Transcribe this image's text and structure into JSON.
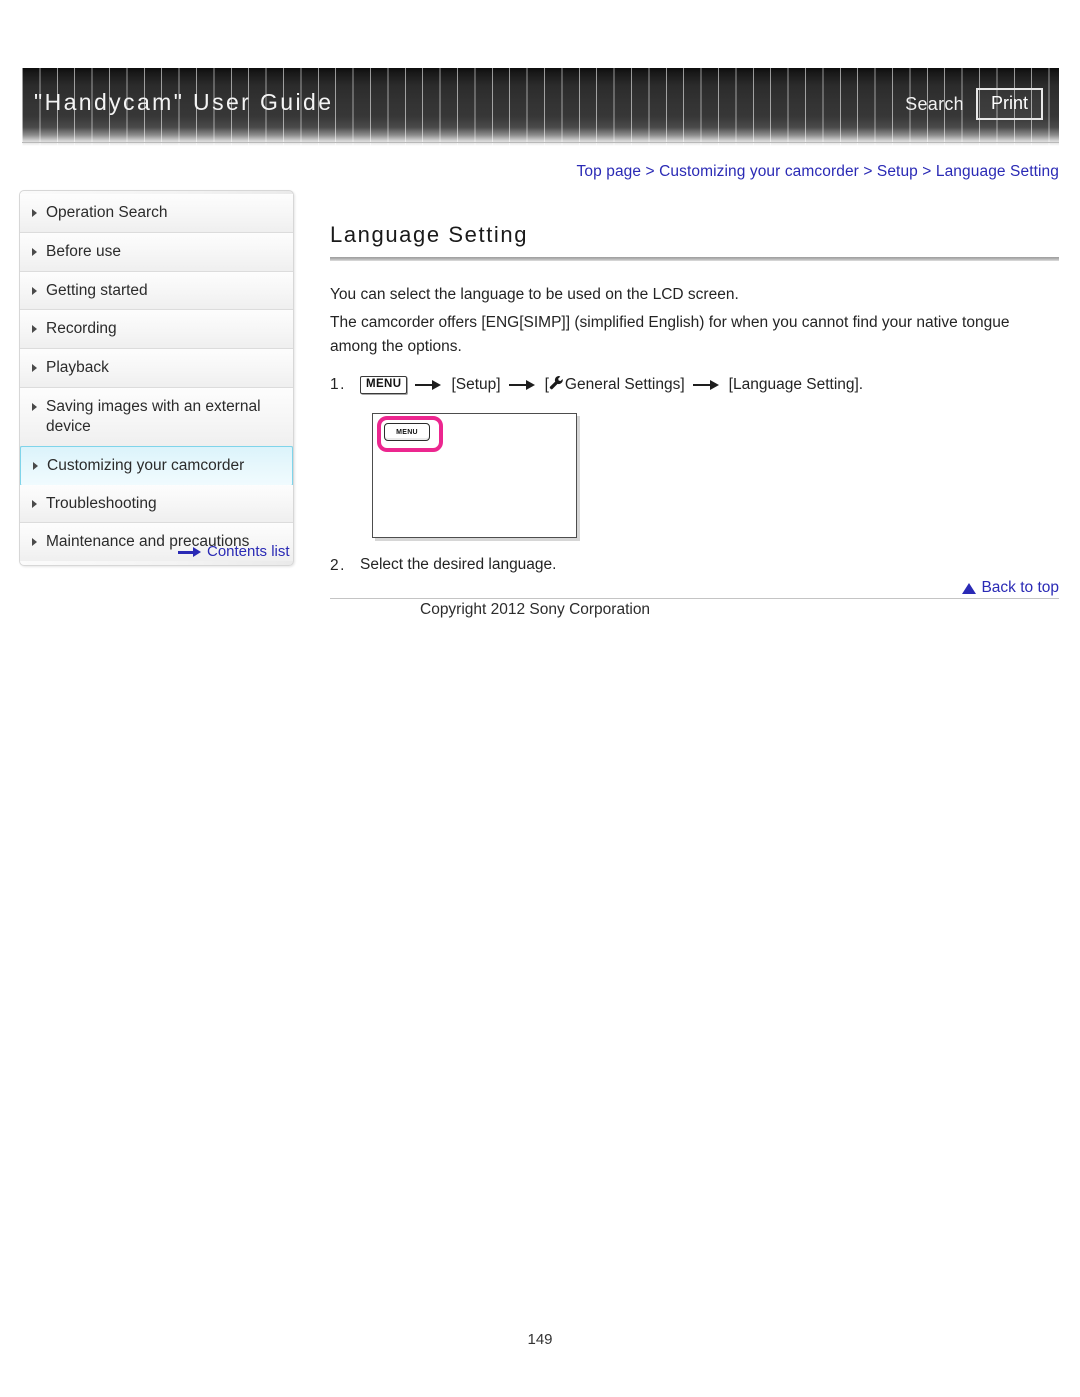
{
  "header": {
    "title": "\"Handycam\" User Guide",
    "search_label": "Search",
    "print_label": "Print"
  },
  "breadcrumb": {
    "text": "Top page > Customizing your camcorder > Setup > Language Setting"
  },
  "sidebar": {
    "items": [
      {
        "label": "Operation Search",
        "active": false
      },
      {
        "label": "Before use",
        "active": false
      },
      {
        "label": "Getting started",
        "active": false
      },
      {
        "label": "Recording",
        "active": false
      },
      {
        "label": "Playback",
        "active": false
      },
      {
        "label": "Saving images with an external device",
        "active": false
      },
      {
        "label": "Customizing your camcorder",
        "active": true
      },
      {
        "label": "Troubleshooting",
        "active": false
      },
      {
        "label": "Maintenance and precautions",
        "active": false
      }
    ],
    "contents_list_label": "Contents list"
  },
  "main": {
    "title": "Language Setting",
    "paragraph1": "You can select the language to be used on the LCD screen.",
    "paragraph2": "The camcorder offers [ENG[SIMP]] (simplified English) for when you cannot find your native tongue among the options.",
    "step1": {
      "number": "1.",
      "menu_chip": "MENU",
      "token_setup": "[Setup]",
      "token_general": "General Settings]",
      "token_general_prefix": "[",
      "token_language": "[Language Setting]."
    },
    "figure": {
      "lcd_menu_label": "MENU"
    },
    "step2": {
      "number": "2.",
      "text": "Select the desired language."
    }
  },
  "footer": {
    "back_to_top_label": "Back to top",
    "copyright": "Copyright 2012 Sony Corporation",
    "page_number": "149"
  },
  "colors": {
    "link": "#2a2ab5",
    "highlight_border": "#7fd4ea",
    "highlight_bg": "#e2f6fc",
    "annotation": "#ec268f"
  }
}
